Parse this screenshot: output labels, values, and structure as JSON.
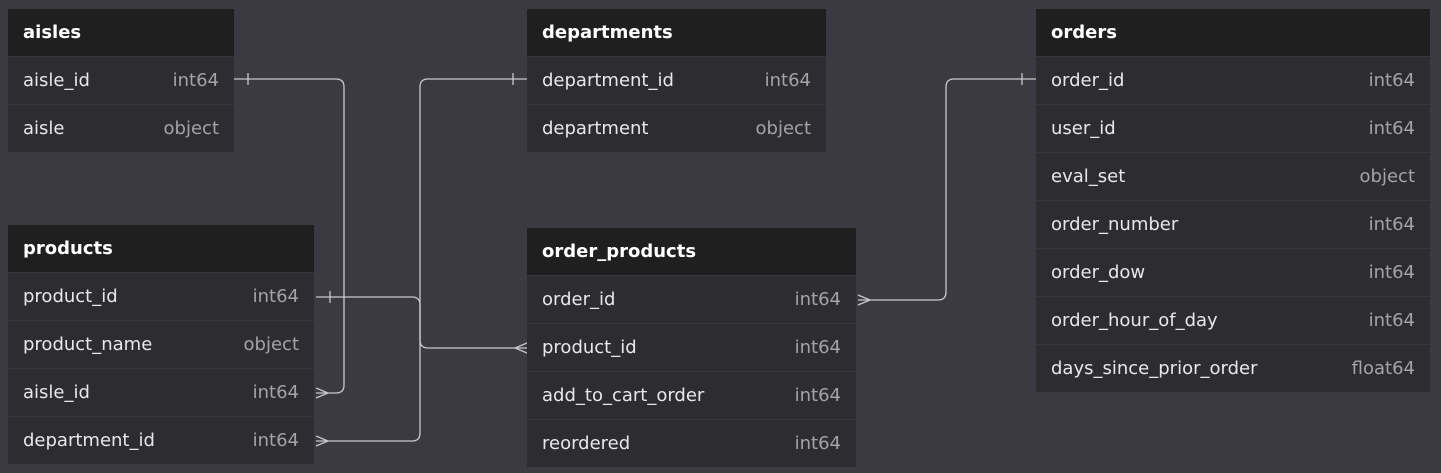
{
  "colors": {
    "background": "#3b3a42",
    "header": "#1f1f1f",
    "body": "#2d2d31",
    "connector": "#c8c8cc"
  },
  "entities": {
    "aisles": {
      "name": "aisles",
      "columns": [
        {
          "name": "aisle_id",
          "type": "int64"
        },
        {
          "name": "aisle",
          "type": "object"
        }
      ]
    },
    "departments": {
      "name": "departments",
      "columns": [
        {
          "name": "department_id",
          "type": "int64"
        },
        {
          "name": "department",
          "type": "object"
        }
      ]
    },
    "orders": {
      "name": "orders",
      "columns": [
        {
          "name": "order_id",
          "type": "int64"
        },
        {
          "name": "user_id",
          "type": "int64"
        },
        {
          "name": "eval_set",
          "type": "object"
        },
        {
          "name": "order_number",
          "type": "int64"
        },
        {
          "name": "order_dow",
          "type": "int64"
        },
        {
          "name": "order_hour_of_day",
          "type": "int64"
        },
        {
          "name": "days_since_prior_order",
          "type": "float64"
        }
      ]
    },
    "products": {
      "name": "products",
      "columns": [
        {
          "name": "product_id",
          "type": "int64"
        },
        {
          "name": "product_name",
          "type": "object"
        },
        {
          "name": "aisle_id",
          "type": "int64"
        },
        {
          "name": "department_id",
          "type": "int64"
        }
      ]
    },
    "order_products": {
      "name": "order_products",
      "columns": [
        {
          "name": "order_id",
          "type": "int64"
        },
        {
          "name": "product_id",
          "type": "int64"
        },
        {
          "name": "add_to_cart_order",
          "type": "int64"
        },
        {
          "name": "reordered",
          "type": "int64"
        }
      ]
    }
  }
}
